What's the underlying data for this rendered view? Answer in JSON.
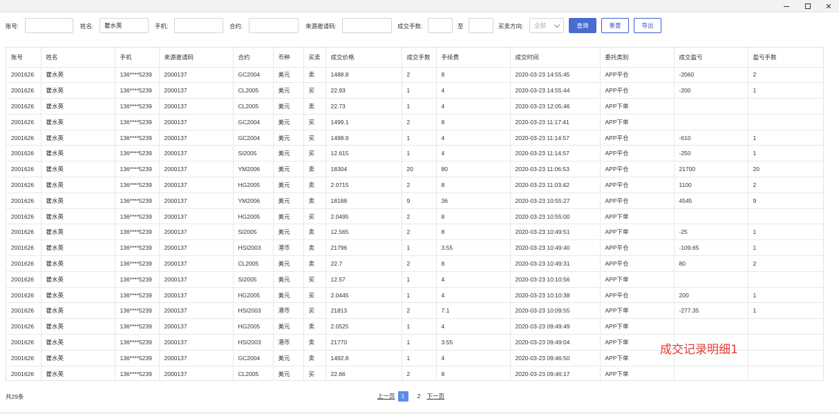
{
  "window": {
    "minimize_glyph": "",
    "maximize_glyph": "",
    "close_glyph": "✕"
  },
  "filters": {
    "account_label": "账号:",
    "account_value": "",
    "name_label": "姓名:",
    "name_value": "瞿水英",
    "phone_label": "手机:",
    "phone_value": "",
    "contract_label": "合约:",
    "contract_value": "",
    "invite_label": "来源邀请码:",
    "invite_value": "",
    "lots_label": "成交手数:",
    "lots_from": "",
    "lots_to_label": "至",
    "lots_to": "",
    "direction_label": "买卖方向:",
    "direction_value": "全部",
    "query_button": "查询",
    "reset_button": "重置",
    "export_button": "导出"
  },
  "table": {
    "columns": [
      "账号",
      "姓名",
      "手机",
      "来源邀请码",
      "合约",
      "币种",
      "买卖",
      "成交价格",
      "成交手数",
      "手续费",
      "成交时间",
      "委托类别",
      "成交盈亏",
      "盈亏手数"
    ],
    "rows": [
      [
        "2001626",
        "瞿水英",
        "136****5239",
        "2000137",
        "GC2004",
        "美元",
        "卖",
        "1488.8",
        "2",
        "8",
        "2020-03-23 14:55:45",
        "APP平仓",
        "-2060",
        "2"
      ],
      [
        "2001626",
        "瞿水英",
        "136****5239",
        "2000137",
        "CL2005",
        "美元",
        "买",
        "22.93",
        "1",
        "4",
        "2020-03-23 14:55:44",
        "APP平仓",
        "-200",
        "1"
      ],
      [
        "2001626",
        "瞿水英",
        "136****5239",
        "2000137",
        "CL2005",
        "美元",
        "卖",
        "22.73",
        "1",
        "4",
        "2020-03-23 12:05:46",
        "APP下单",
        "",
        ""
      ],
      [
        "2001626",
        "瞿水英",
        "136****5239",
        "2000137",
        "GC2004",
        "美元",
        "买",
        "1499.1",
        "2",
        "8",
        "2020-03-23 11:17:41",
        "APP下单",
        "",
        ""
      ],
      [
        "2001626",
        "瞿水英",
        "136****5239",
        "2000137",
        "GC2004",
        "美元",
        "买",
        "1498.9",
        "1",
        "4",
        "2020-03-23 11:14:57",
        "APP平仓",
        "-610",
        "1"
      ],
      [
        "2001626",
        "瞿水英",
        "136****5239",
        "2000137",
        "SI2005",
        "美元",
        "买",
        "12.615",
        "1",
        "4",
        "2020-03-23 11:14:57",
        "APP平仓",
        "-250",
        "1"
      ],
      [
        "2001626",
        "瞿水英",
        "136****5239",
        "2000137",
        "YM2006",
        "美元",
        "卖",
        "18304",
        "20",
        "80",
        "2020-03-23 11:06:53",
        "APP平仓",
        "21700",
        "20"
      ],
      [
        "2001626",
        "瞿水英",
        "136****5239",
        "2000137",
        "HG2005",
        "美元",
        "卖",
        "2.0715",
        "2",
        "8",
        "2020-03-23 11:03:42",
        "APP平仓",
        "1100",
        "2"
      ],
      [
        "2001626",
        "瞿水英",
        "136****5239",
        "2000137",
        "YM2006",
        "美元",
        "卖",
        "18188",
        "9",
        "36",
        "2020-03-23 10:55:27",
        "APP平仓",
        "4545",
        "9"
      ],
      [
        "2001626",
        "瞿水英",
        "136****5239",
        "2000137",
        "HG2005",
        "美元",
        "买",
        "2.0495",
        "2",
        "8",
        "2020-03-23 10:55:00",
        "APP下单",
        "",
        ""
      ],
      [
        "2001626",
        "瞿水英",
        "136****5239",
        "2000137",
        "SI2005",
        "美元",
        "卖",
        "12.565",
        "2",
        "8",
        "2020-03-23 10:49:51",
        "APP下单",
        "-25",
        "1"
      ],
      [
        "2001626",
        "瞿水英",
        "136****5239",
        "2000137",
        "HSI2003",
        "港币",
        "卖",
        "21796",
        "1",
        "3.55",
        "2020-03-23 10:49:40",
        "APP平仓",
        "-109.65",
        "1"
      ],
      [
        "2001626",
        "瞿水英",
        "136****5239",
        "2000137",
        "CL2005",
        "美元",
        "卖",
        "22.7",
        "2",
        "8",
        "2020-03-23 10:49:31",
        "APP平仓",
        "80",
        "2"
      ],
      [
        "2001626",
        "瞿水英",
        "136****5239",
        "2000137",
        "SI2005",
        "美元",
        "买",
        "12.57",
        "1",
        "4",
        "2020-03-23 10:10:56",
        "APP下单",
        "",
        ""
      ],
      [
        "2001626",
        "瞿水英",
        "136****5239",
        "2000137",
        "HG2005",
        "美元",
        "买",
        "2.0445",
        "1",
        "4",
        "2020-03-23 10:10:38",
        "APP平仓",
        "200",
        "1"
      ],
      [
        "2001626",
        "瞿水英",
        "136****5239",
        "2000137",
        "HSI2003",
        "港币",
        "买",
        "21813",
        "2",
        "7.1",
        "2020-03-23 10:09:55",
        "APP下单",
        "-277.35",
        "1"
      ],
      [
        "2001626",
        "瞿水英",
        "136****5239",
        "2000137",
        "HG2005",
        "美元",
        "卖",
        "2.0525",
        "1",
        "4",
        "2020-03-23 09:49:49",
        "APP下单",
        "",
        ""
      ],
      [
        "2001626",
        "瞿水英",
        "136****5239",
        "2000137",
        "HSI2003",
        "港币",
        "卖",
        "21770",
        "1",
        "3.55",
        "2020-03-23 09:49:04",
        "APP下单",
        "",
        ""
      ],
      [
        "2001626",
        "瞿水英",
        "136****5239",
        "2000137",
        "GC2004",
        "美元",
        "卖",
        "1492.8",
        "1",
        "4",
        "2020-03-23 09:46:50",
        "APP下单",
        "",
        ""
      ],
      [
        "2001626",
        "瞿水英",
        "136****5239",
        "2000137",
        "CL2005",
        "美元",
        "买",
        "22.66",
        "2",
        "8",
        "2020-03-23 09:46:17",
        "APP下单",
        "",
        ""
      ]
    ]
  },
  "watermark": "成交记录明细1",
  "footer": {
    "total": "共29条",
    "prev": "上一页",
    "pages": [
      "1",
      "2"
    ],
    "current_page": "1",
    "next": "下一页"
  }
}
